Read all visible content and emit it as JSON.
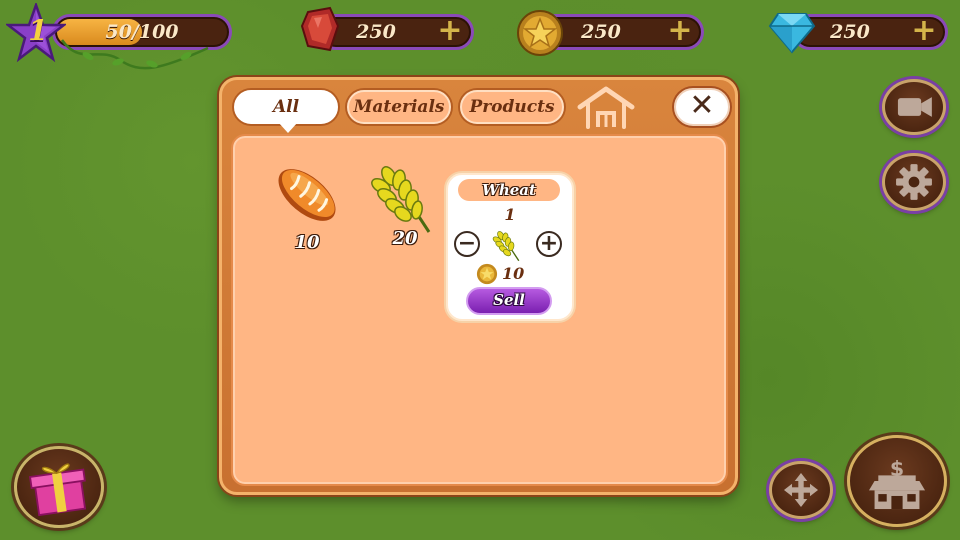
{
  "hud": {
    "level": "1",
    "xp_text": "50/100",
    "xp_progress": 0.5,
    "rubies": "250",
    "coins": "250",
    "gems": "250",
    "plus_symbol": "+"
  },
  "tabs": [
    {
      "label": "All",
      "active": true
    },
    {
      "label": "Materials",
      "active": false
    },
    {
      "label": "Products",
      "active": false
    }
  ],
  "close_symbol": "✕",
  "items": [
    {
      "name": "bread",
      "icon": "bread-icon",
      "count": "10"
    },
    {
      "name": "wheat",
      "icon": "wheat-icon",
      "count": "20"
    }
  ],
  "sell_popup": {
    "title": "Wheat",
    "quantity": "1",
    "price": "10",
    "minus_symbol": "−",
    "plus_symbol": "+",
    "sell_label": "Sell"
  },
  "colors": {
    "panel": "#c87030",
    "panel_inner": "#ffb684",
    "sell_button": "#8e2fc4",
    "hud_border": "#8a4ab8",
    "grass": "#5d8f2c"
  }
}
